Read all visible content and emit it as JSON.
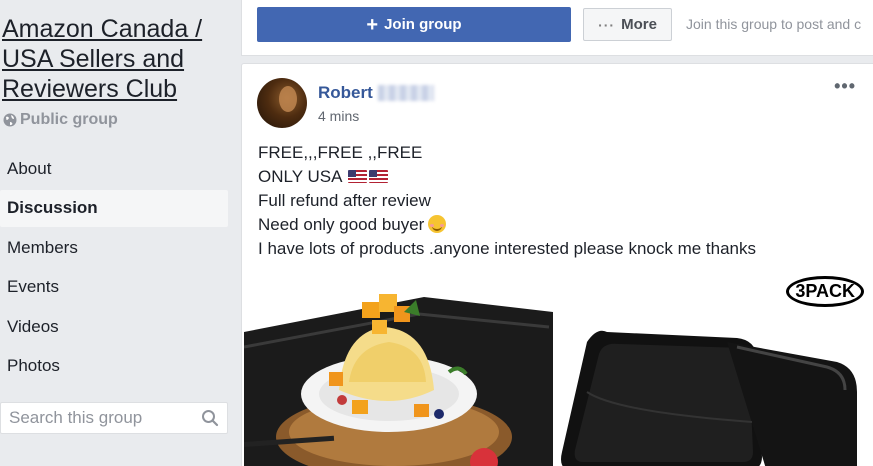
{
  "group": {
    "title": "Amazon Canada / USA Sellers and Reviewers Club",
    "type_label": "Public group"
  },
  "nav": {
    "items": [
      {
        "label": "About"
      },
      {
        "label": "Discussion",
        "active": true
      },
      {
        "label": "Members"
      },
      {
        "label": "Events"
      },
      {
        "label": "Videos"
      },
      {
        "label": "Photos"
      }
    ]
  },
  "search": {
    "placeholder": "Search this group"
  },
  "topbar": {
    "join_label": "Join group",
    "more_label": "More",
    "hint": "Join this group to post and c"
  },
  "post": {
    "author_first": "Robert",
    "time": "4 mins",
    "lines": [
      "FREE,,,FREE ,,FREE",
      "ONLY USA",
      "Full refund after review",
      "Need only good buyer",
      "I have lots of products .anyone interested please knock me thanks"
    ],
    "image2_badge": "3PACK"
  },
  "colors": {
    "accent": "#4267b2",
    "link": "#365899",
    "background": "#e9ebee"
  },
  "icons": [
    "globe-icon",
    "search-icon",
    "plus-icon",
    "more-dots-icon",
    "post-menu-icon",
    "us-flag-icon",
    "smile-emoji-icon"
  ]
}
